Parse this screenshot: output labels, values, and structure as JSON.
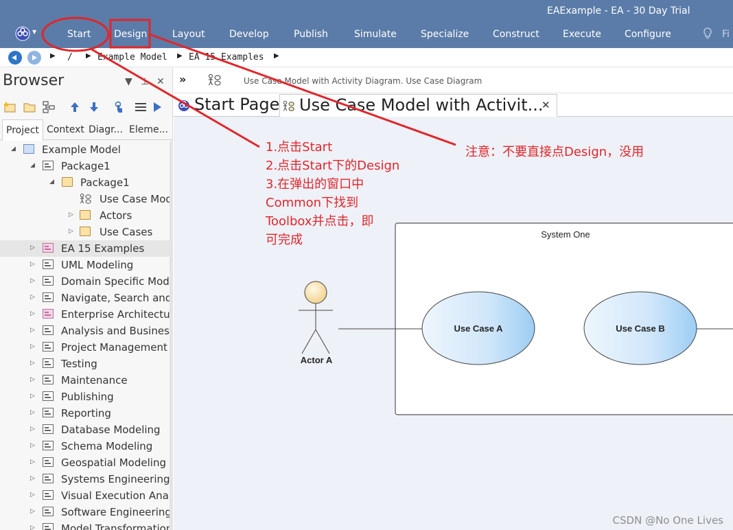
{
  "window": {
    "title": "EAExample - EA - 30 Day Trial"
  },
  "ribbon": {
    "tabs": [
      "Start",
      "Design",
      "Layout",
      "Develop",
      "Publish",
      "Simulate",
      "Specialize",
      "Construct",
      "Execute",
      "Configure"
    ],
    "search_text": "Fi",
    "logo_icon": "ea-logo-icon",
    "color": "#5b7ca8"
  },
  "breadcrumb": {
    "items": [
      "/",
      "Example Model",
      "EA 15 Examples"
    ]
  },
  "browser": {
    "title": "Browser",
    "tabs": [
      "Project",
      "Context",
      "Diagr...",
      "Eleme..."
    ],
    "tree": [
      {
        "label": "Example Model",
        "level": 0,
        "expander": "open",
        "icon": "model"
      },
      {
        "label": "Package1",
        "level": 1,
        "expander": "open",
        "icon": "package"
      },
      {
        "label": "Package1",
        "level": 2,
        "expander": "open",
        "icon": "folder"
      },
      {
        "label": "Use Case Model with Activity Diagram",
        "level": 3,
        "expander": "none",
        "icon": "usecase-diagram"
      },
      {
        "label": "Actors",
        "level": 3,
        "expander": "closed",
        "icon": "folder"
      },
      {
        "label": "Use Cases",
        "level": 3,
        "expander": "closed",
        "icon": "folder"
      },
      {
        "label": "EA 15 Examples",
        "level": 1,
        "expander": "closed",
        "icon": "package-pink",
        "selected": true
      },
      {
        "label": "UML Modeling",
        "level": 1,
        "expander": "closed",
        "icon": "package"
      },
      {
        "label": "Domain Specific Modeling",
        "level": 1,
        "expander": "closed",
        "icon": "package"
      },
      {
        "label": "Navigate, Search and Trace",
        "level": 1,
        "expander": "closed",
        "icon": "package"
      },
      {
        "label": "Enterprise Architecture",
        "level": 1,
        "expander": "closed",
        "icon": "package-pink"
      },
      {
        "label": "Analysis and Business",
        "level": 1,
        "expander": "closed",
        "icon": "package"
      },
      {
        "label": "Project Management",
        "level": 1,
        "expander": "closed",
        "icon": "package"
      },
      {
        "label": "Testing",
        "level": 1,
        "expander": "closed",
        "icon": "package"
      },
      {
        "label": "Maintenance",
        "level": 1,
        "expander": "closed",
        "icon": "package"
      },
      {
        "label": "Publishing",
        "level": 1,
        "expander": "closed",
        "icon": "package"
      },
      {
        "label": "Reporting",
        "level": 1,
        "expander": "closed",
        "icon": "package"
      },
      {
        "label": "Database Modeling",
        "level": 1,
        "expander": "closed",
        "icon": "package"
      },
      {
        "label": "Schema Modeling",
        "level": 1,
        "expander": "closed",
        "icon": "package"
      },
      {
        "label": "Geospatial Modeling",
        "level": 1,
        "expander": "closed",
        "icon": "package"
      },
      {
        "label": "Systems Engineering",
        "level": 1,
        "expander": "closed",
        "icon": "package"
      },
      {
        "label": "Visual Execution Analysis",
        "level": 1,
        "expander": "closed",
        "icon": "package"
      },
      {
        "label": "Software Engineering",
        "level": 1,
        "expander": "closed",
        "icon": "package"
      },
      {
        "label": "Model Transformation",
        "level": 1,
        "expander": "closed",
        "icon": "package"
      }
    ]
  },
  "diagram": {
    "path_text": "Use Case Model with Activity Diagram.  Use Case Diagram",
    "tabs": [
      {
        "label": "Start Page",
        "icon": "ea-logo-icon"
      },
      {
        "label": "Use Case Model with Activit...",
        "icon": "usecase-diagram-icon",
        "active": true
      }
    ],
    "system_boundary": "System One",
    "actor": "Actor A",
    "use_cases": [
      "Use Case A",
      "Use Case B"
    ]
  },
  "annotations": {
    "steps": [
      "1.点击Start",
      "2.点击Start下的Design",
      "3.在弹出的窗口中",
      "Common下找到",
      "Toolbox并点击，即",
      "可完成"
    ],
    "warning": "注意：不要直接点Design，没用",
    "color": "#e0262b"
  },
  "watermark": "CSDN @No One Lives"
}
